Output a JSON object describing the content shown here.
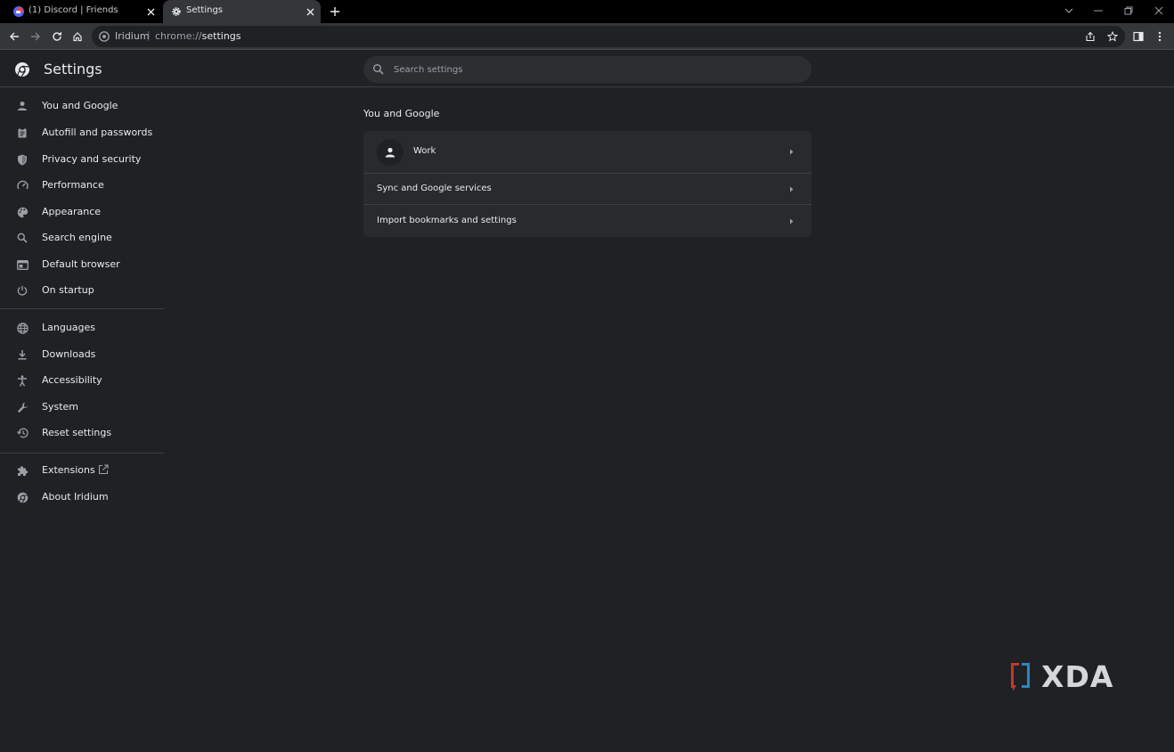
{
  "tabs": [
    {
      "title": "(1) Discord | Friends",
      "active": false
    },
    {
      "title": "Settings",
      "active": true
    }
  ],
  "toolbar": {
    "site_name": "Iridium",
    "url_scheme": "chrome://",
    "url_path": "settings"
  },
  "header": {
    "title": "Settings",
    "search_placeholder": "Search settings"
  },
  "sidebar": {
    "items": [
      {
        "label": "You and Google",
        "icon": "person-icon"
      },
      {
        "label": "Autofill and passwords",
        "icon": "clipboard-icon"
      },
      {
        "label": "Privacy and security",
        "icon": "shield-icon"
      },
      {
        "label": "Performance",
        "icon": "speedometer-icon"
      },
      {
        "label": "Appearance",
        "icon": "palette-icon"
      },
      {
        "label": "Search engine",
        "icon": "search-icon"
      },
      {
        "label": "Default browser",
        "icon": "browser-window-icon"
      },
      {
        "label": "On startup",
        "icon": "power-icon"
      },
      {
        "label": "Languages",
        "icon": "globe-icon"
      },
      {
        "label": "Downloads",
        "icon": "download-icon"
      },
      {
        "label": "Accessibility",
        "icon": "accessibility-icon"
      },
      {
        "label": "System",
        "icon": "wrench-icon"
      },
      {
        "label": "Reset settings",
        "icon": "history-icon"
      },
      {
        "label": "Extensions",
        "icon": "puzzle-icon"
      },
      {
        "label": "About Iridium",
        "icon": "iridium-logo-icon"
      }
    ]
  },
  "main": {
    "section_title": "You and Google",
    "rows": [
      {
        "label": "Work"
      },
      {
        "label": "Sync and Google services"
      },
      {
        "label": "Import bookmarks and settings"
      }
    ]
  },
  "watermark": {
    "text": "XDA"
  },
  "colors": {
    "background": "#202124",
    "tabstrip": "#000000",
    "toolbar": "#35363a",
    "card": "#292a2d",
    "watermark_red": "#c0392b",
    "watermark_blue": "#2e86c1"
  }
}
